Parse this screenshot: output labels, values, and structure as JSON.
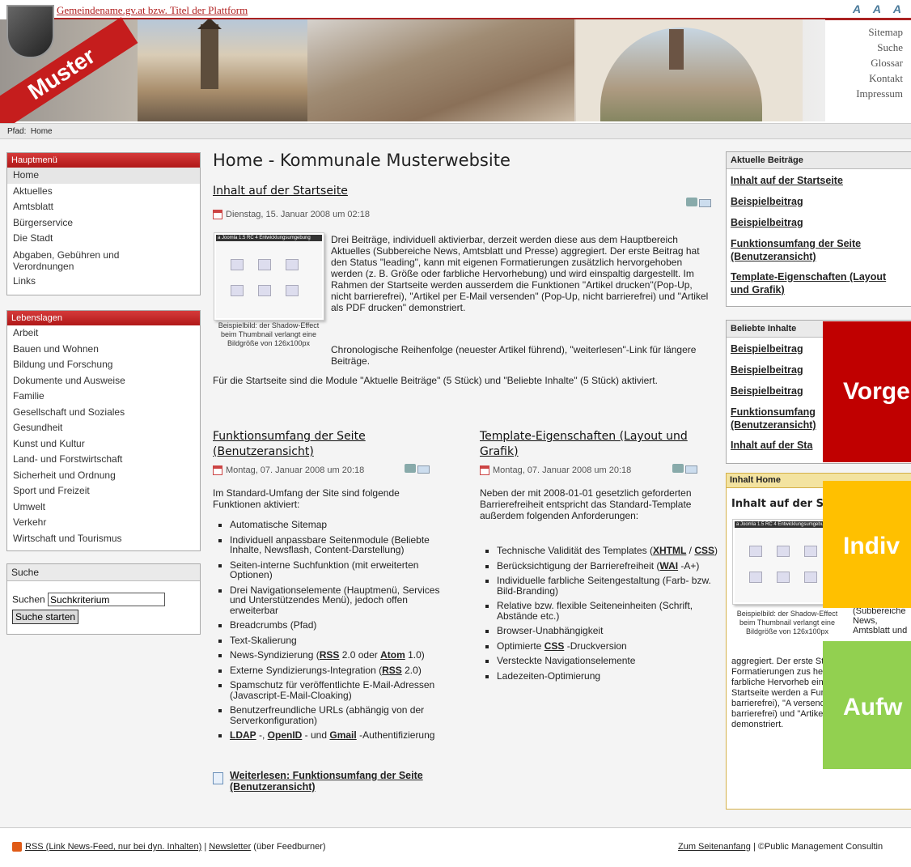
{
  "header": {
    "site_title": "Gemeindename.gv.at bzw. Titel der Plattform",
    "logo_text": "Muster",
    "font_size_controls": "A A A",
    "topnav": [
      "Sitemap",
      "Suche",
      "Glossar",
      "Kontakt",
      "Impressum"
    ]
  },
  "path": {
    "label": "Pfad:",
    "current": "Home"
  },
  "main_menu": {
    "title": "Hauptmenü",
    "items": [
      "Home",
      "Aktuelles",
      "Amtsblatt",
      "Bürgerservice",
      "Die Stadt",
      "Abgaben, Gebühren und Verordnungen",
      "Links"
    ]
  },
  "lebenslagen": {
    "title": "Lebenslagen",
    "items": [
      "Arbeit",
      "Bauen und Wohnen",
      "Bildung und Forschung",
      "Dokumente und Ausweise",
      "Familie",
      "Gesellschaft und Soziales",
      "Gesundheit",
      "Kunst und Kultur",
      "Land- und Forstwirtschaft",
      "Sicherheit und Ordnung",
      "Sport und Freizeit",
      "Umwelt",
      "Verkehr",
      "Wirtschaft und Tourismus"
    ]
  },
  "search": {
    "title": "Suche",
    "label": "Suchen",
    "value": "Suchkriterium",
    "button": "Suche starten"
  },
  "main": {
    "title": "Home - Kommunale Musterwebsite",
    "article1": {
      "title": "Inhalt auf der Startseite",
      "date": "Dienstag, 15. Januar 2008 um 02:18",
      "thumb_caption": "Beispielbild: der Shadow-Effect beim Thumbnail verlangt eine Bildgröße von 126x100px",
      "thumb_header": "a Joomla 1.5 RC 4 Entwicklungsumgebung",
      "para1": "Drei Beiträge, individuell aktivierbar, derzeit werden diese aus dem Hauptbereich Aktuelles (Subbereiche News, Amtsblatt und Presse) aggregiert. Der erste Beitrag hat den Status \"leading\", kann mit eigenen Formatierungen zusätzlich hervorgehoben werden (z. B. Größe oder farbliche Hervorhebung) und wird einspaltig dargestellt. Im Rahmen der Startseite werden ausserdem die Funktionen \"Artikel drucken\"(Pop-Up, nicht barrierefrei), \"Artikel per E-Mail versenden\" (Pop-Up, nicht barrierefrei) und \"Artikel als PDF drucken\" demonstriert.",
      "para2": "Chronologische Reihenfolge (neuester Artikel führend), \"weiterlesen\"-Link für längere Beiträge.",
      "para3": "Für die Startseite sind die Module \"Aktuelle Beiträge\" (5 Stück) und \"Beliebte Inhalte\" (5 Stück) aktiviert."
    },
    "article2": {
      "title": "Funktionsumfang der Seite (Benutzeransicht)",
      "date": "Montag, 07. Januar 2008 um 20:18",
      "intro": "Im Standard-Umfang der Site sind folgende Funktionen aktiviert:",
      "items": [
        "Automatische Sitemap",
        "Individuell anpassbare Seitenmodule (Beliebte Inhalte, Newsflash, Content-Darstellung)",
        "Seiten-interne Suchfunktion (mit erweiterten Optionen)",
        "Drei Navigationselemente (Hauptmenü, Services und Unterstützendes Menü), jedoch offen erweiterbar",
        "Breadcrumbs (Pfad)",
        "Text-Skalierung"
      ],
      "rss_item": {
        "pre": "News-Syndizierung (",
        "rss": "RSS",
        "mid": " 2.0 oder ",
        "atom": "Atom",
        "post": " 1.0)"
      },
      "ext_item": {
        "pre": "Externe Syndizierungs-Integration (",
        "rss": "RSS",
        "post": " 2.0)"
      },
      "spam_item": "Spamschutz für veröffentlichte E-Mail-Adressen (Javascript-E-Mail-Cloaking)",
      "url_item": "Benutzerfreundliche URLs (abhängig von der Serverkonfiguration)",
      "auth_item": {
        "ldap": "LDAP",
        "sep1": " -, ",
        "openid": "OpenID",
        "sep2": " - und ",
        "gmail": "Gmail",
        "post": " -Authentifizierung"
      },
      "readmore": "Weiterlesen: Funktionsumfang der Seite (Benutzeransicht)"
    },
    "article3": {
      "title": "Template-Eigenschaften (Layout und Grafik)",
      "date": "Montag, 07. Januar 2008 um 20:18",
      "intro": "Neben der mit 2008-01-01 gesetzlich geforderten Barrierefreiheit entspricht das Standard-Template außerdem folgenden Anforderungen:",
      "valid": {
        "pre": "Technische Validität des Templates (",
        "xhtml": "XHTML",
        "mid": " / ",
        "css": "CSS",
        "post": ")"
      },
      "wai": {
        "pre": "Berücksichtigung der Barrierefreiheit (",
        "wai": "WAI",
        "post": " -A+)"
      },
      "items": [
        "Individuelle farbliche Seitengestaltung (Farb- bzw. Bild-Branding)",
        "Relative bzw. flexible Seiteneinheiten (Schrift, Abstände etc.)",
        "Browser-Unabhängigkeit"
      ],
      "css_item": {
        "pre": "Optimierte ",
        "css": "CSS",
        "post": " -Druckversion"
      },
      "items2": [
        "Versteckte Navigationselemente",
        "Ladezeiten-Optimierung"
      ]
    }
  },
  "right": {
    "recent": {
      "title": "Aktuelle Beiträge",
      "items": [
        "Inhalt auf der Startseite",
        "Beispielbeitrag",
        "Beispielbeitrag",
        "Funktionsumfang der Seite (Benutzeransicht)",
        "Template-Eigenschaften (Layout und Grafik)"
      ]
    },
    "popular": {
      "title": "Beliebte Inhalte",
      "items": [
        "Beispielbeitrag",
        "Beispielbeitrag",
        "Beispielbeitrag",
        "Funktionsumfang (Benutzeransicht)",
        "Inhalt auf der Sta"
      ]
    },
    "home": {
      "title": "Inhalt Home",
      "subtitle": "Inhalt auf der Sta",
      "thumb_caption": "Beispielbild: der Shadow-Effect beim Thumbnail verlangt eine Bildgröße von 126x100px",
      "side_text": "(Subbereiche News, Amtsblatt und",
      "text": "aggregiert. Der erste Status \"leading\", ka Formatierungen zus hervorgehoben wer farbliche Hervorheb einspaltig dargestel Startseite werden a Funktionen \"Artikel nicht barrierefrei), \"A versenden\" (Pop-Up, nicht barrierefrei) und \"Artikel als PDF drucken\" demonstriert."
    }
  },
  "overlays": [
    {
      "label": "Vorge",
      "color": "#c00000"
    },
    {
      "label": "Indiv",
      "color": "#ffc000"
    },
    {
      "label": "Aufw",
      "color": "#92d050"
    }
  ],
  "footer": {
    "rss_link": "RSS (Link News-Feed, nur bei dyn. Inhalten)",
    "sep": " | ",
    "newsletter": "Newsletter",
    "newsletter_post": " (über Feedburner)",
    "top_link": "Zum Seitenanfang",
    "copyright": " | ©Public Management Consultin"
  }
}
